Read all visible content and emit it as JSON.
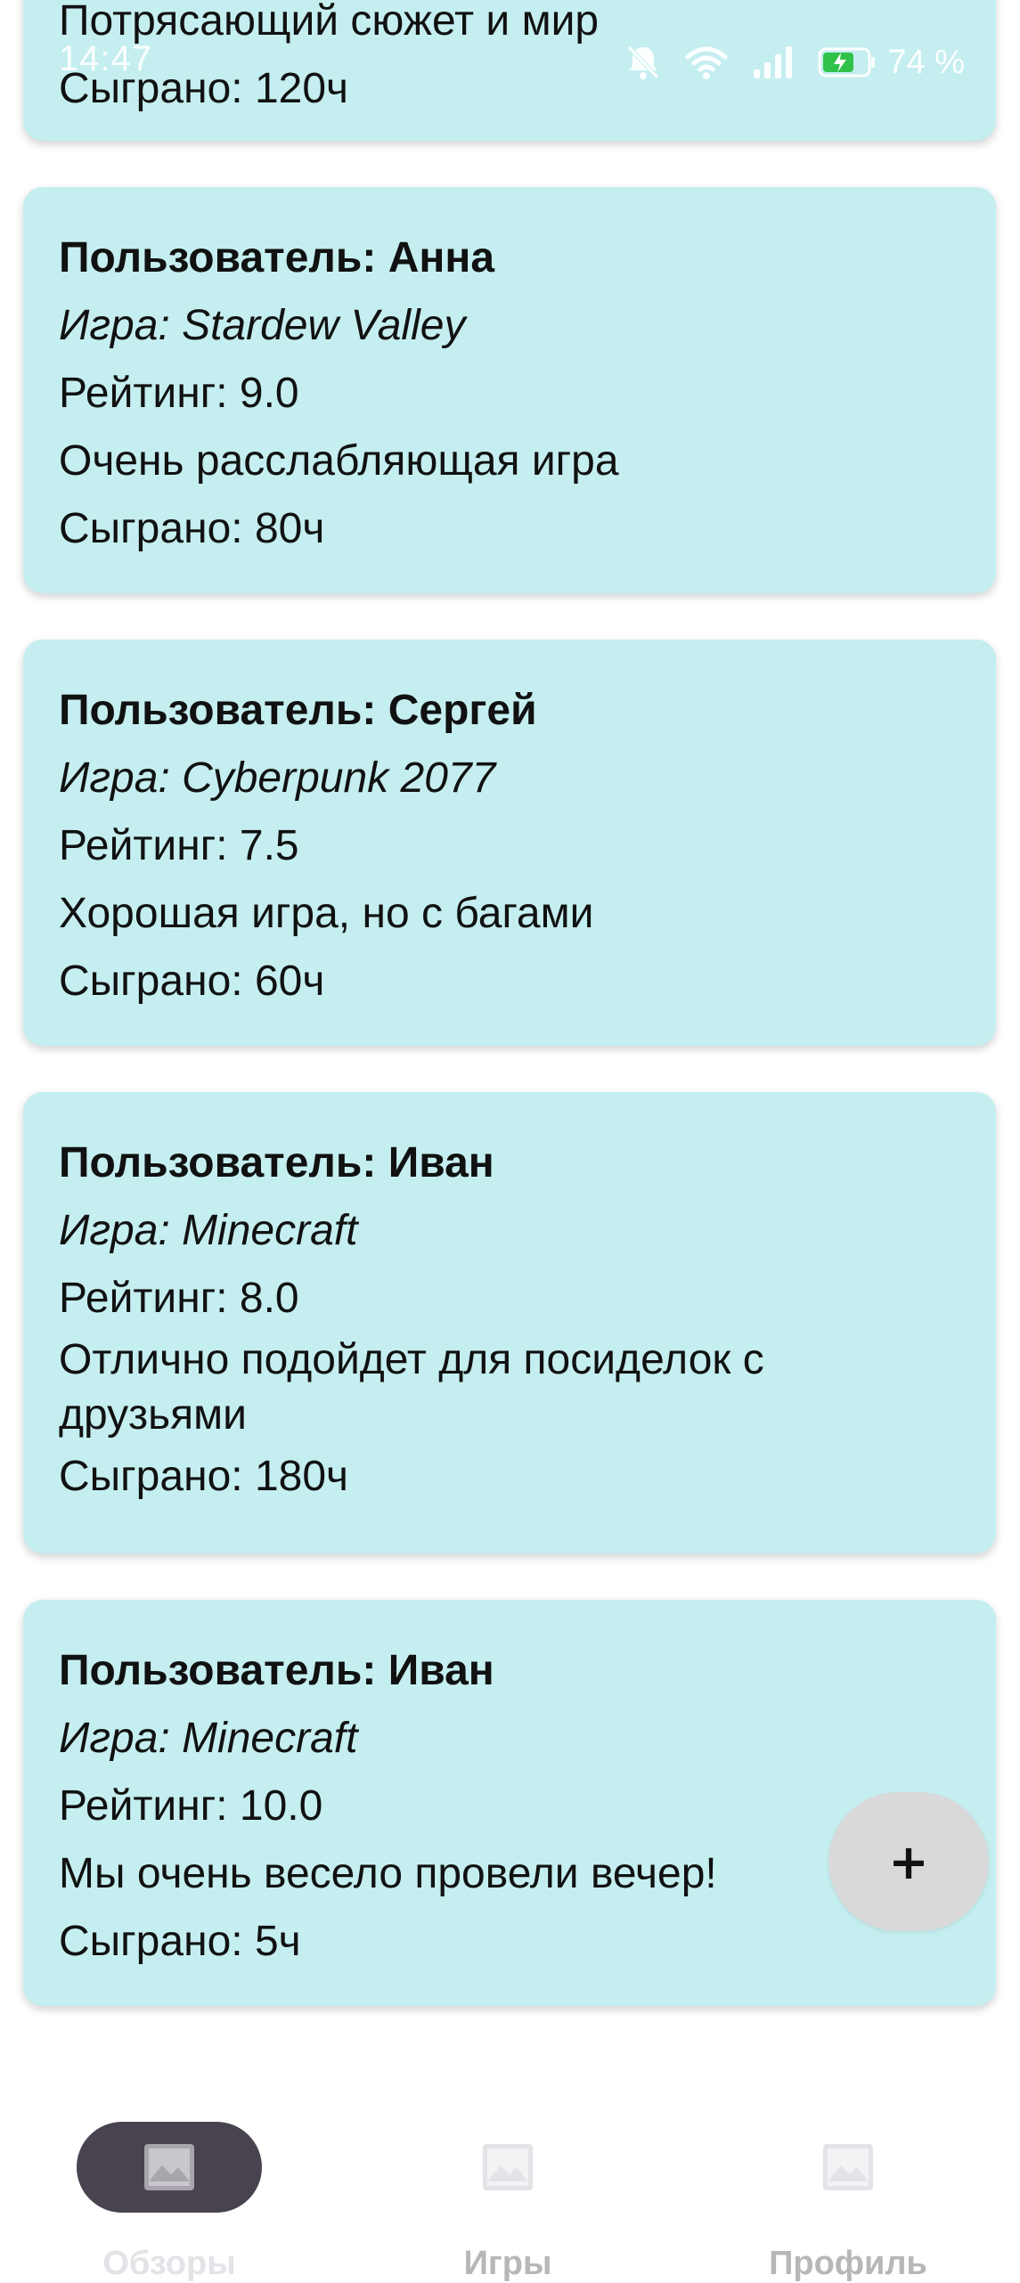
{
  "status_bar": {
    "time": "14:47",
    "battery_percent": "74 %",
    "icons": [
      "bell-off-icon",
      "wifi-icon",
      "signal-icon",
      "battery-charging-icon"
    ]
  },
  "reviews": [
    {
      "user": "",
      "game": "",
      "rating": "",
      "comment": "Потрясающий сюжет и мир",
      "played": "Сыграно: 120ч"
    },
    {
      "user": "Пользователь: Анна",
      "game": "Игра: Stardew Valley",
      "rating": "Рейтинг: 9.0",
      "comment": "Очень расслабляющая игра",
      "played": "Сыграно: 80ч"
    },
    {
      "user": "Пользователь: Сергей",
      "game": "Игра: Cyberpunk 2077",
      "rating": "Рейтинг: 7.5",
      "comment": "Хорошая игра, но с багами",
      "played": "Сыграно: 60ч"
    },
    {
      "user": "Пользователь: Иван",
      "game": "Игра: Minecraft",
      "rating": "Рейтинг: 8.0",
      "comment": "Отлично подойдет для посиделок с друзьями",
      "played": "Сыграно: 180ч"
    },
    {
      "user": "Пользователь: Иван",
      "game": "Игра: Minecraft",
      "rating": "Рейтинг: 10.0",
      "comment": "Мы очень весело провели вечер!",
      "played": "Сыграно: 5ч"
    }
  ],
  "fab": {
    "label": "+",
    "icon": "plus-icon"
  },
  "bottom_nav": {
    "items": [
      {
        "label": "Обзоры",
        "icon": "image-icon",
        "active": true
      },
      {
        "label": "Игры",
        "icon": "image-icon",
        "active": false
      },
      {
        "label": "Профиль",
        "icon": "image-icon",
        "active": false
      }
    ]
  },
  "colors": {
    "card_background": "#c5eef0",
    "nav_active_pill": "#48434f",
    "fab_background": "#d9d9d9",
    "nav_label_inactive": "#b7b7b7"
  }
}
